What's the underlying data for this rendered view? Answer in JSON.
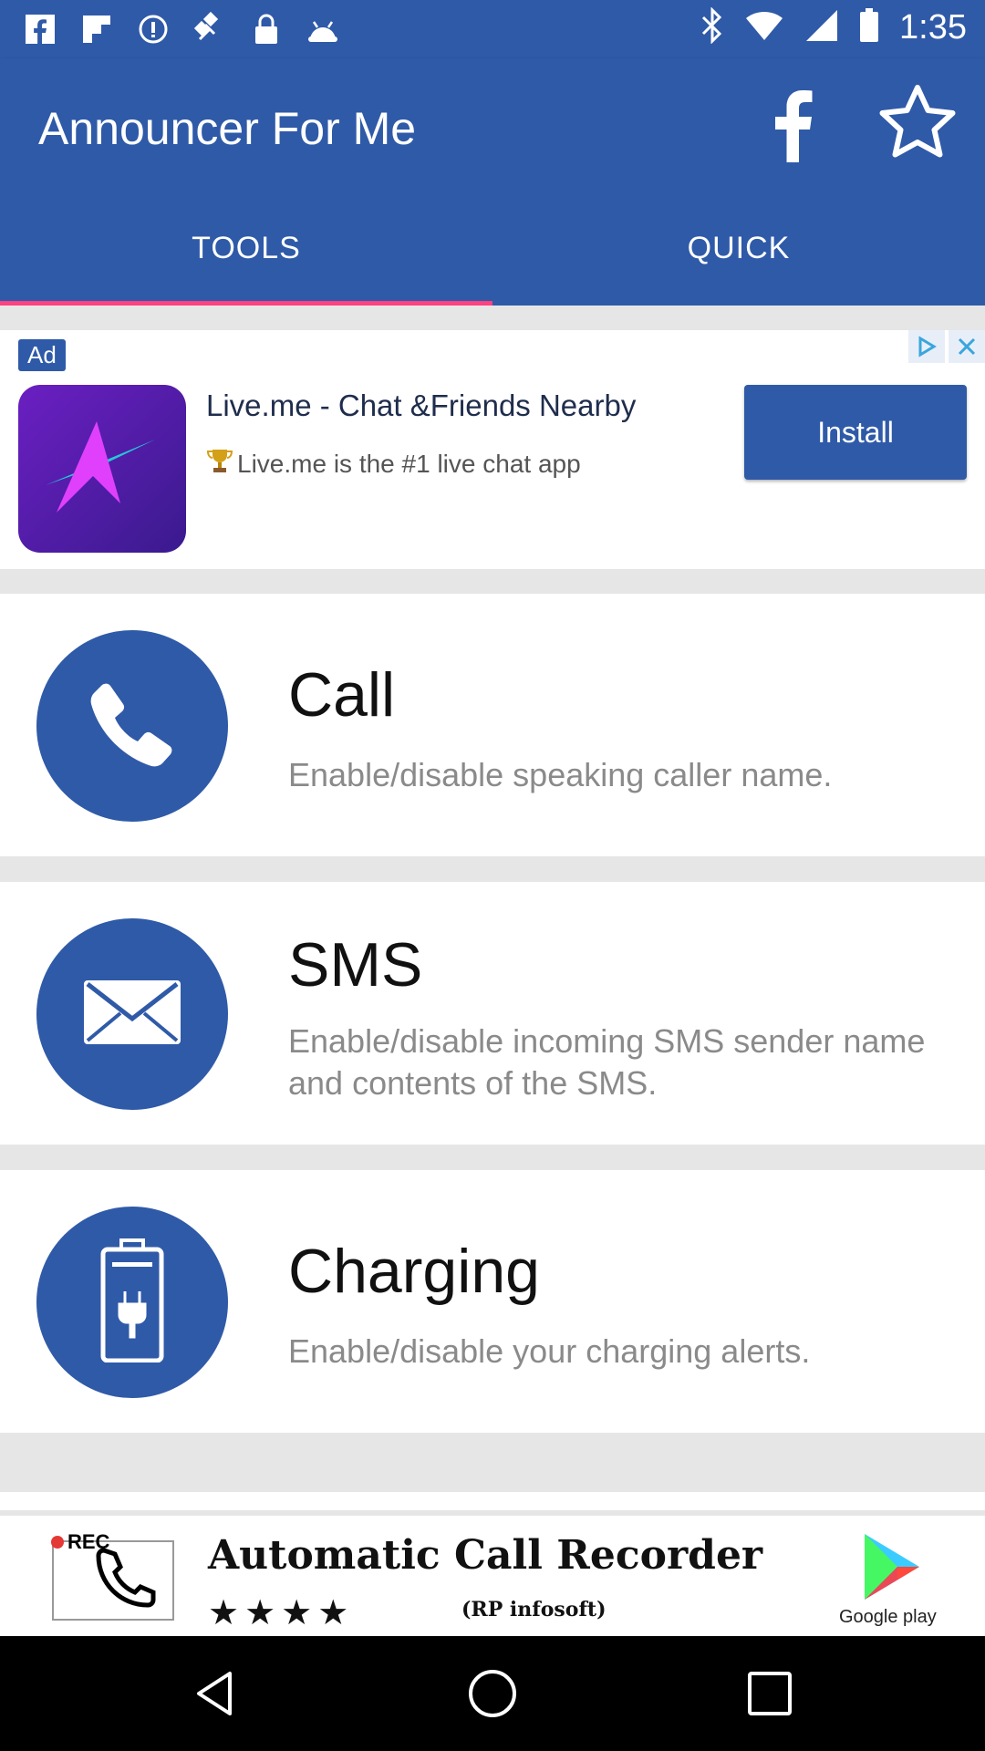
{
  "status_bar": {
    "time": "1:35",
    "left_icons": [
      "facebook-icon",
      "flipboard-icon",
      "data-saver-icon",
      "fake-gps-icon",
      "lock-icon",
      "android-icon"
    ],
    "right_icons": [
      "bluetooth-icon"
    ]
  },
  "app_bar": {
    "title": "Announcer For Me",
    "actions": [
      "facebook-icon",
      "star-icon"
    ]
  },
  "tabs": [
    {
      "label": "TOOLS",
      "active": true
    },
    {
      "label": "QUICK",
      "active": false
    }
  ],
  "ad": {
    "tag": "Ad",
    "headline": "Live.me - Chat &Friends Nearby",
    "body": "Live.me is the #1 live chat app",
    "button": "Install"
  },
  "cards": [
    {
      "title": "Call",
      "description": "Enable/disable speaking caller name.",
      "icon": "phone-icon"
    },
    {
      "title": "SMS",
      "description": "Enable/disable incoming SMS sender name and contents of the SMS.",
      "icon": "mail-icon"
    },
    {
      "title": "Charging",
      "description": "Enable/disable your charging alerts.",
      "icon": "battery-charging-icon"
    }
  ],
  "banner": {
    "rec_label": "REC",
    "title": "Automatic Call Recorder",
    "stars": "★★★★",
    "developer": "(RP infosoft)",
    "store": "Google play"
  },
  "colors": {
    "primary": "#2f5aa8",
    "tab_indicator": "#ff4081"
  }
}
